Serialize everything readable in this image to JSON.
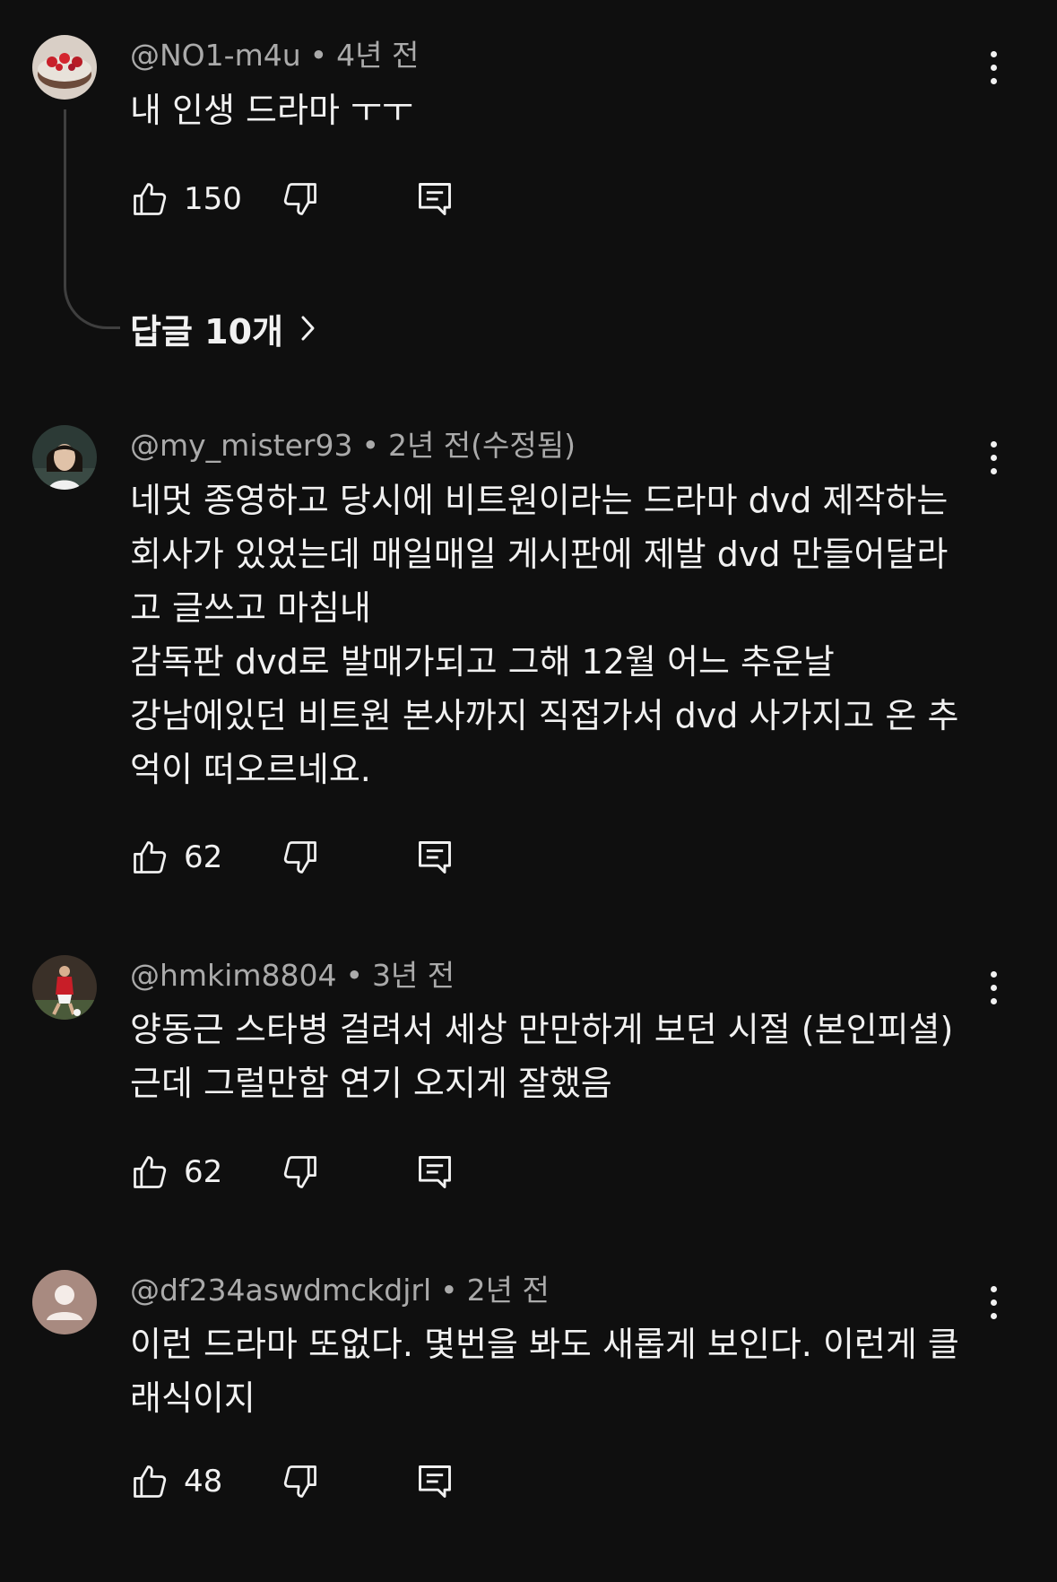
{
  "comments": [
    {
      "author": "@NO1-m4u",
      "age": "4년 전",
      "text_lines": [
        "내 인생 드라마 ㅜㅜ"
      ],
      "likes": "150",
      "avatar_icon": "cake-photo-avatar",
      "replies_label": "답글 10개"
    },
    {
      "author": "@my_mister93",
      "age": "2년 전(수정됨)",
      "text_lines": [
        "네멋 종영하고 당시에 비트원이라는 드라마 dvd 제작하는",
        "회사가 있었는데  매일매일 게시판에 제발 dvd 만들어달라",
        "고 글쓰고 마침내",
        "감독판 dvd로 발매가되고 그해 12월 어느 추운날",
        "강남에있던 비트원 본사까지 직접가서 dvd 사가지고 온 추",
        "억이 떠오르네요."
      ],
      "likes": "62",
      "avatar_icon": "person-photo-avatar"
    },
    {
      "author": "@hmkim8804",
      "age": "3년 전",
      "text_lines": [
        "양동근 스타병 걸려서 세상 만만하게 보던 시절 (본인피셜)",
        "근데 그럴만함 연기 오지게 잘했음"
      ],
      "likes": "62",
      "avatar_icon": "soccer-photo-avatar"
    },
    {
      "author": "@df234aswdmckdjrl",
      "age": "2년 전",
      "text_lines": [
        "이런 드라마 또없다. 몇번을 봐도 새롭게 보인다. 이런게 클",
        "래식이지"
      ],
      "likes": "48",
      "avatar_icon": "default-person-avatar"
    }
  ],
  "colors": {
    "background": "#0f0f0f",
    "text": "#f1f1f1",
    "meta": "#aaaaaa",
    "thread_line": "#3f3f3f",
    "default_avatar_bg": "#a88a80"
  }
}
